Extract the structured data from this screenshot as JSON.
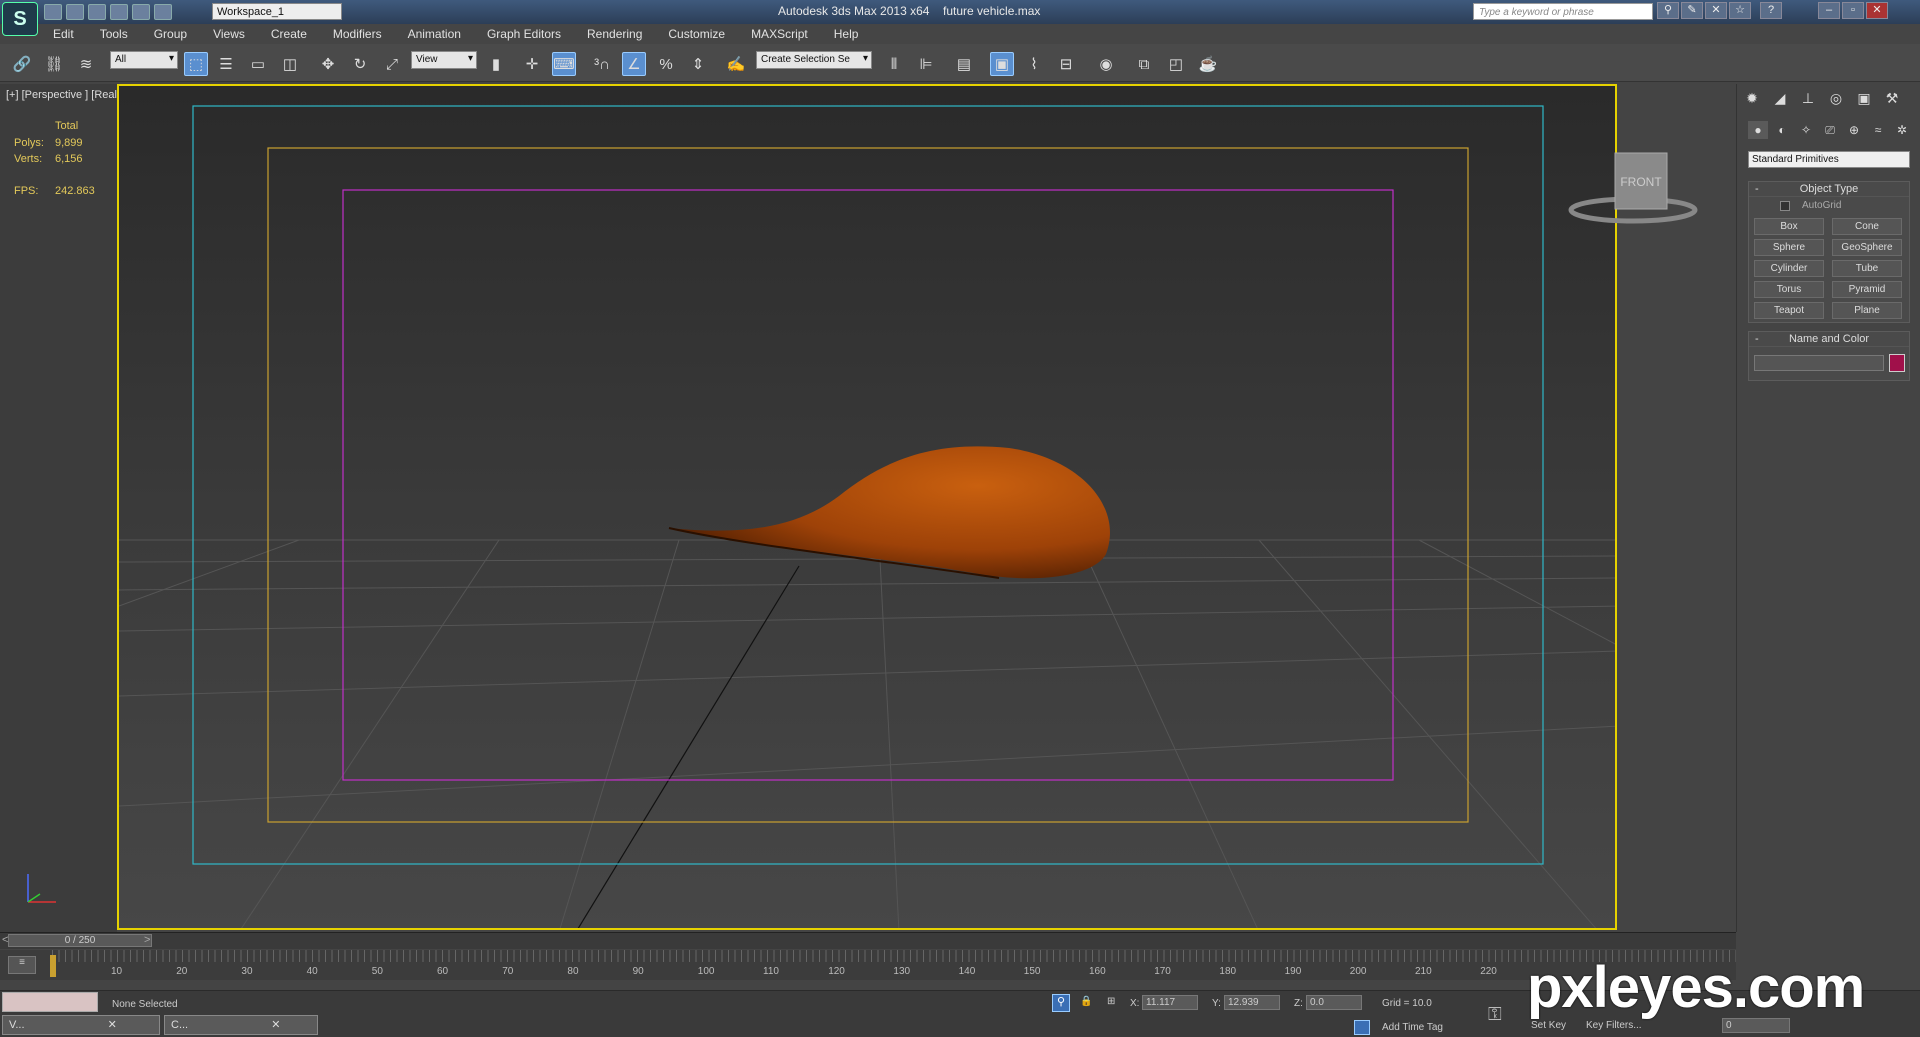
{
  "titlebar": {
    "workspace": "Workspace_1",
    "app_title": "Autodesk 3ds Max  2013 x64",
    "file_title": "future vehicle.max",
    "search_placeholder": "Type a keyword or phrase"
  },
  "menu": [
    "Edit",
    "Tools",
    "Group",
    "Views",
    "Create",
    "Modifiers",
    "Animation",
    "Graph Editors",
    "Rendering",
    "Customize",
    "MAXScript",
    "Help"
  ],
  "toolbar": {
    "filter": "All",
    "ref_coord": "View",
    "selection_set": "Create Selection Se"
  },
  "viewport": {
    "label": "[+] [Perspective ] [Realistic ]",
    "stats": {
      "total_label": "Total",
      "polys_label": "Polys:",
      "polys": "9,899",
      "verts_label": "Verts:",
      "verts": "6,156",
      "fps_label": "FPS:",
      "fps": "242.863"
    },
    "viewcube_label": "FRONT",
    "object_color": "#b5500c"
  },
  "command_panel": {
    "category": "Standard Primitives",
    "object_type_title": "Object Type",
    "autogrid": "AutoGrid",
    "buttons": [
      "Box",
      "Cone",
      "Sphere",
      "GeoSphere",
      "Cylinder",
      "Tube",
      "Torus",
      "Pyramid",
      "Teapot",
      "Plane"
    ],
    "name_color_title": "Name and Color",
    "swatch_color": "#a0104a"
  },
  "timeline": {
    "frame": "0 / 250",
    "ticks": [
      "10",
      "20",
      "30",
      "40",
      "50",
      "60",
      "70",
      "80",
      "90",
      "100",
      "110",
      "120",
      "130",
      "140",
      "150",
      "160",
      "170",
      "180",
      "190",
      "200",
      "210",
      "220"
    ]
  },
  "status": {
    "selection": "None Selected",
    "x_label": "X:",
    "x": "11.117",
    "y_label": "Y:",
    "y": "12.939",
    "z_label": "Z:",
    "z": "0.0",
    "grid": "Grid = 10.0",
    "add_time_tag": "Add Time Tag",
    "set_key": "Set Key",
    "key_filters": "Key Filters...",
    "frame_field": "0",
    "task1": "V...",
    "task2": "C..."
  },
  "watermark": "pxleyes.com"
}
